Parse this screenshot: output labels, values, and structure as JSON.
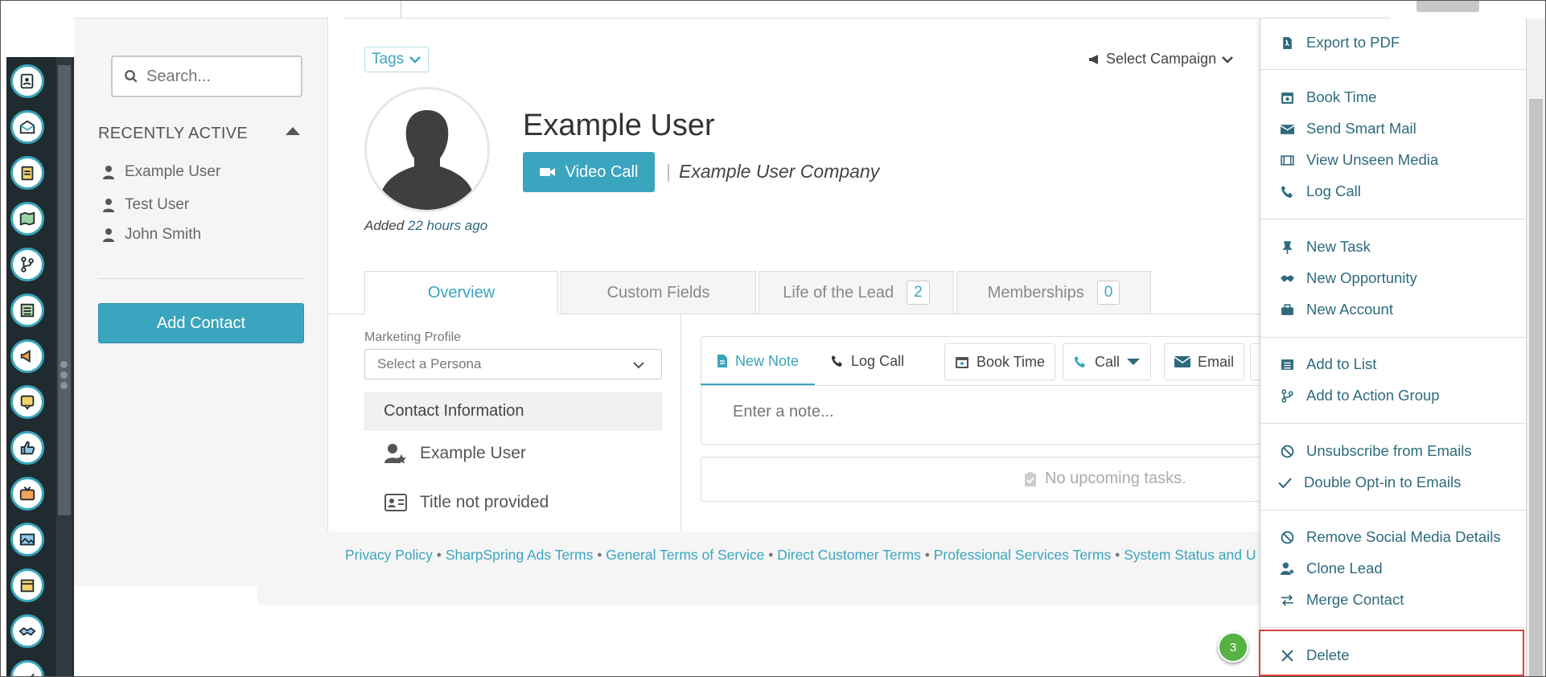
{
  "sidebar_rail": {
    "icons": [
      "contacts-icon",
      "inbox-icon",
      "clipboard-icon",
      "map-icon",
      "branch-icon",
      "list-icon",
      "megaphone-icon",
      "chat-icon",
      "thumbs-up-icon",
      "tv-icon",
      "image-icon",
      "calendar-icon",
      "handshake-icon",
      "chart-icon"
    ]
  },
  "left_panel": {
    "search_placeholder": "Search...",
    "recently_active_heading": "RECENTLY ACTIVE",
    "recent_items": [
      "Example User",
      "Test User",
      "John Smith"
    ],
    "add_contact_label": "Add Contact"
  },
  "header": {
    "tags_label": "Tags",
    "select_campaign_label": "Select Campaign",
    "user_name": "Example User",
    "video_call_label": "Video Call",
    "company": "Example User Company",
    "added_prefix": "Added",
    "added_time": "22 hours ago"
  },
  "tabs": [
    {
      "label": "Overview",
      "count": null
    },
    {
      "label": "Custom Fields",
      "count": null
    },
    {
      "label": "Life of the Lead",
      "count": "2"
    },
    {
      "label": "Memberships",
      "count": "0"
    }
  ],
  "overview": {
    "marketing_profile_label": "Marketing Profile",
    "persona_placeholder": "Select a Persona",
    "contact_info_heading": "Contact Information",
    "contact_name": "Example User",
    "contact_title": "Title not provided"
  },
  "activity": {
    "tabs": [
      "New Note",
      "Log Call"
    ],
    "buttons": [
      "Book Time",
      "Call",
      "Email"
    ],
    "note_placeholder": "Enter a note...",
    "no_tasks": "No upcoming tasks."
  },
  "footer": {
    "links": [
      "Privacy Policy",
      "SharpSpring Ads Terms",
      "General Terms of Service",
      "Direct Customer Terms",
      "Professional Services Terms",
      "System Status and U"
    ],
    "separator": "•"
  },
  "dropdown": {
    "items": [
      {
        "label": "Export to PDF",
        "icon": "pdf-icon"
      },
      {
        "label": "Book Time",
        "icon": "calendar-icon"
      },
      {
        "label": "Send Smart Mail",
        "icon": "envelope-icon"
      },
      {
        "label": "View Unseen Media",
        "icon": "film-icon"
      },
      {
        "label": "Log Call",
        "icon": "phone-icon"
      },
      {
        "label": "New Task",
        "icon": "pin-icon"
      },
      {
        "label": "New Opportunity",
        "icon": "handshake-icon"
      },
      {
        "label": "New Account",
        "icon": "briefcase-icon"
      },
      {
        "label": "Add to List",
        "icon": "list-icon"
      },
      {
        "label": "Add to Action Group",
        "icon": "branch-icon"
      },
      {
        "label": "Unsubscribe from Emails",
        "icon": "ban-icon"
      },
      {
        "label": "Double Opt-in to Emails",
        "icon": "check-icon"
      },
      {
        "label": "Remove Social Media Details",
        "icon": "ban-icon"
      },
      {
        "label": "Clone Lead",
        "icon": "user-star-icon"
      },
      {
        "label": "Merge Contact",
        "icon": "swap-icon"
      },
      {
        "label": "Delete",
        "icon": "close-icon"
      }
    ]
  },
  "annotation": {
    "step_number": "3"
  },
  "colors": {
    "accent": "#3aa5be",
    "rail": "#1f2b2f",
    "highlight": "#e0403c",
    "badge": "#57b143",
    "link": "#2e6a7d"
  }
}
